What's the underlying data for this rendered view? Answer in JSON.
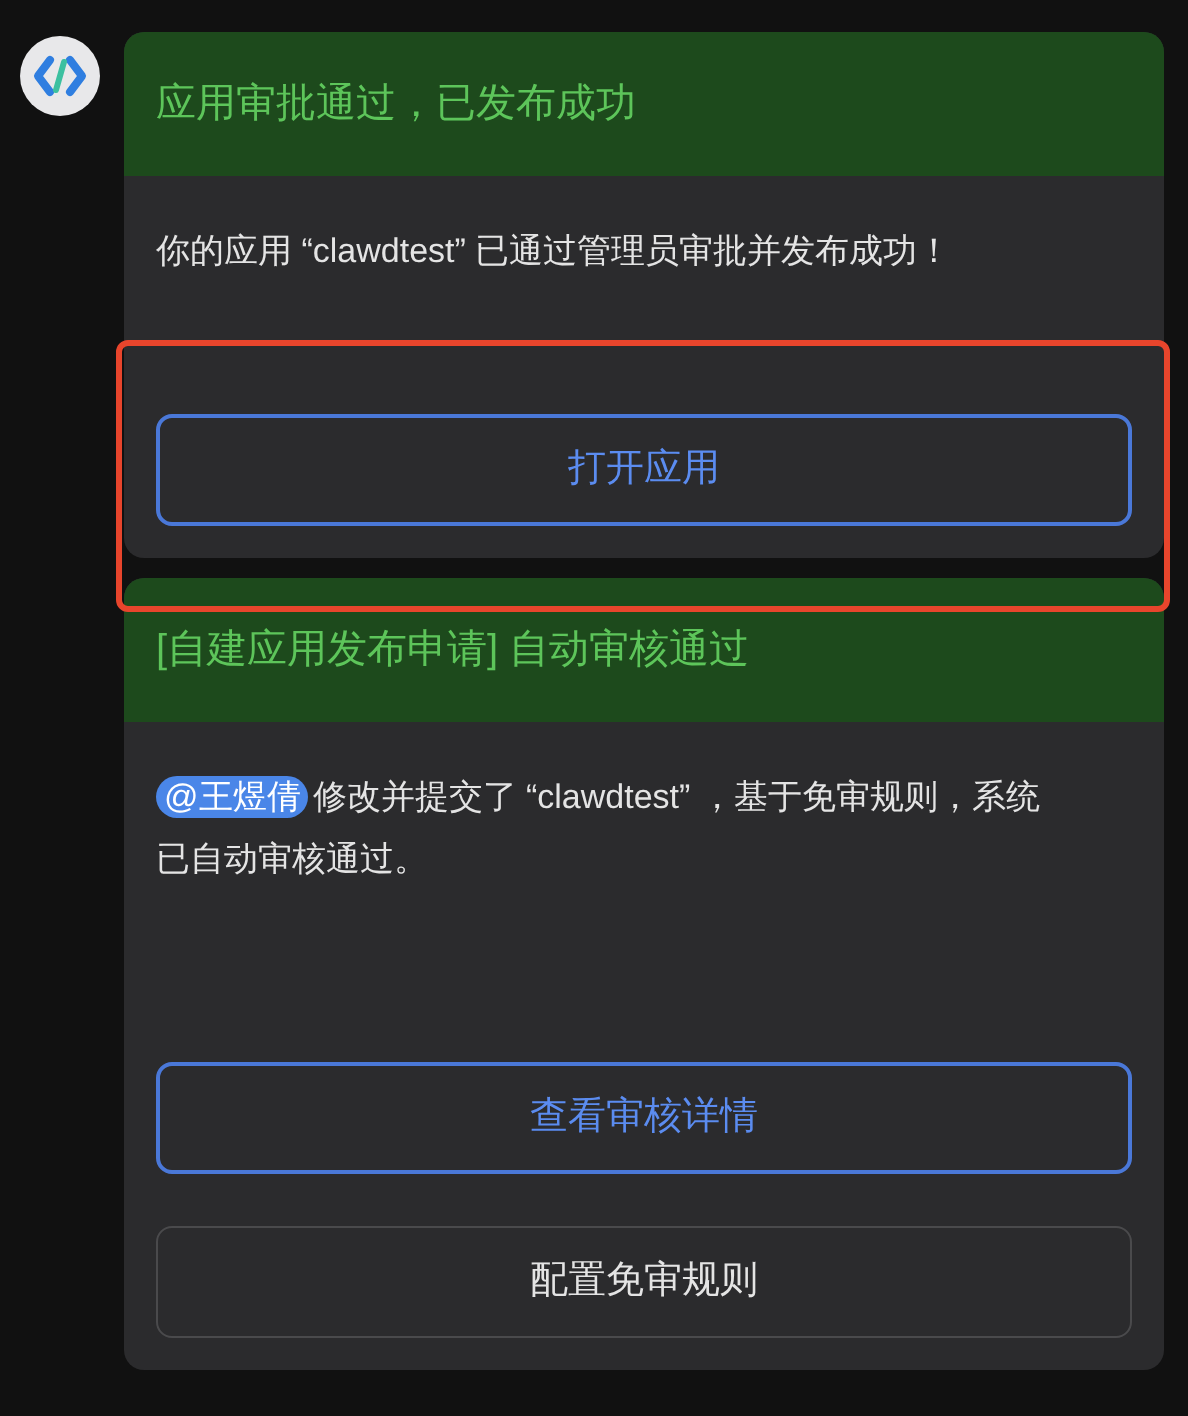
{
  "cards": [
    {
      "title": "应用审批通过，已发布成功",
      "body": [
        {
          "kind": "text",
          "text": "你的应用 “clawdtest” 已通过管理员审批并发布成功！"
        }
      ],
      "buttons": [
        {
          "label": "打开应用",
          "kind": "primary"
        }
      ],
      "highlighted": true
    },
    {
      "title": "[自建应用发布申请] 自动审核通过",
      "body": [
        {
          "kind": "mention",
          "text": "@王煜倩"
        },
        {
          "kind": "text",
          "text": "修改并提交了 “clawdtest” ，基于免审规则，系统已自动审核通过。"
        }
      ],
      "buttons": [
        {
          "label": "查看审核详情",
          "kind": "primary"
        },
        {
          "label": "配置免审规则",
          "kind": "secondary"
        }
      ],
      "highlighted": false
    }
  ]
}
